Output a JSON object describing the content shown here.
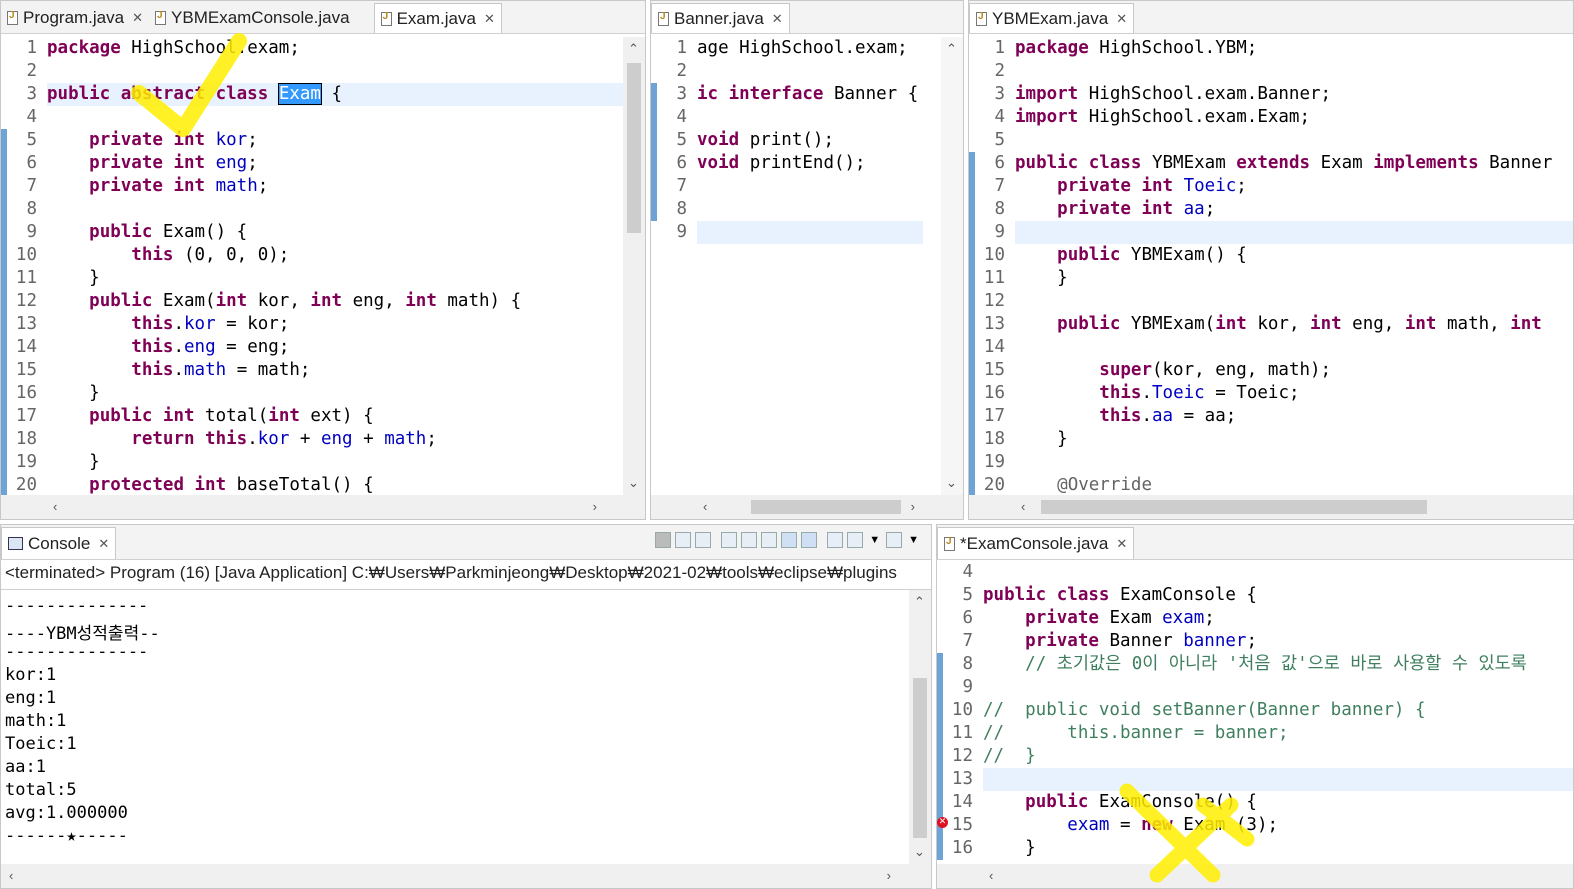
{
  "panes": {
    "left_editor": {
      "tabs": [
        {
          "label": "Program.java",
          "active": false
        },
        {
          "label": "YBMExamConsole.java",
          "active": false
        },
        {
          "label": "Exam.java",
          "active": true
        }
      ],
      "lines": [
        {
          "n": "1",
          "html": "<span class='kw'>package</span> HighSchool.exam;"
        },
        {
          "n": "2",
          "html": ""
        },
        {
          "n": "3",
          "html": "<span class='kw'>public abstract class</span> <span class='sel'>Exam</span> {"
        },
        {
          "n": "4",
          "html": ""
        },
        {
          "n": "5",
          "html": "    <span class='kw'>private int</span> <span class='fd'>kor</span>;"
        },
        {
          "n": "6",
          "html": "    <span class='kw'>private int</span> <span class='fd'>eng</span>;"
        },
        {
          "n": "7",
          "html": "    <span class='kw'>private int</span> <span class='fd'>math</span>;"
        },
        {
          "n": "8",
          "html": ""
        },
        {
          "n": "9",
          "html": "    <span class='kw'>public</span> Exam() {"
        },
        {
          "n": "10",
          "html": "        <span class='kw'>this</span> (0, 0, 0);"
        },
        {
          "n": "11",
          "html": "    }"
        },
        {
          "n": "12",
          "html": "    <span class='kw'>public</span> Exam(<span class='kw'>int</span> kor, <span class='kw'>int</span> eng, <span class='kw'>int</span> math) {"
        },
        {
          "n": "13",
          "html": "        <span class='kw'>this</span>.<span class='fd'>kor</span> = kor;"
        },
        {
          "n": "14",
          "html": "        <span class='kw'>this</span>.<span class='fd'>eng</span> = eng;"
        },
        {
          "n": "15",
          "html": "        <span class='kw'>this</span>.<span class='fd'>math</span> = math;"
        },
        {
          "n": "16",
          "html": "    }"
        },
        {
          "n": "17",
          "html": "    <span class='kw'>public int</span> total(<span class='kw'>int</span> ext) {"
        },
        {
          "n": "18",
          "html": "        <span class='kw'>return this</span>.<span class='fd'>kor</span> + <span class='fd'>eng</span> + <span class='fd'>math</span>;"
        },
        {
          "n": "19",
          "html": "    }"
        },
        {
          "n": "20",
          "html": "    <span class='kw'>protected int</span> baseTotal() {"
        }
      ]
    },
    "mid_editor": {
      "tabs": [
        {
          "label": "Banner.java",
          "active": true
        }
      ],
      "lines": [
        {
          "n": "1",
          "html": "age HighSchool.exam;"
        },
        {
          "n": "2",
          "html": ""
        },
        {
          "n": "3",
          "html": "<span class='kw'>ic interface</span> Banner {"
        },
        {
          "n": "4",
          "html": ""
        },
        {
          "n": "5",
          "html": "<span class='kw'>void</span> print();"
        },
        {
          "n": "6",
          "html": "<span class='kw'>void</span> printEnd();"
        },
        {
          "n": "7",
          "html": ""
        },
        {
          "n": "8",
          "html": ""
        },
        {
          "n": "9",
          "html": ""
        }
      ]
    },
    "right_editor": {
      "tabs": [
        {
          "label": "YBMExam.java",
          "active": true
        }
      ],
      "lines": [
        {
          "n": "1",
          "html": "<span class='kw'>package</span> HighSchool.YBM;"
        },
        {
          "n": "2",
          "html": ""
        },
        {
          "n": "3",
          "html": "<span class='kw'>import</span> HighSchool.exam.Banner;"
        },
        {
          "n": "4",
          "html": "<span class='kw'>import</span> HighSchool.exam.Exam;"
        },
        {
          "n": "5",
          "html": ""
        },
        {
          "n": "6",
          "html": "<span class='kw'>public class</span> YBMExam <span class='kw'>extends</span> Exam <span class='kw'>implements</span> Banner"
        },
        {
          "n": "7",
          "html": "    <span class='kw'>private int</span> <span class='fd'>Toeic</span>;"
        },
        {
          "n": "8",
          "html": "    <span class='kw'>private int</span> <span class='fd'>aa</span>;"
        },
        {
          "n": "9",
          "html": ""
        },
        {
          "n": "10",
          "html": "    <span class='kw'>public</span> YBMExam() {"
        },
        {
          "n": "11",
          "html": "    }"
        },
        {
          "n": "12",
          "html": ""
        },
        {
          "n": "13",
          "html": "    <span class='kw'>public</span> YBMExam(<span class='kw'>int</span> kor, <span class='kw'>int</span> eng, <span class='kw'>int</span> math, <span class='kw'>int</span>"
        },
        {
          "n": "14",
          "html": ""
        },
        {
          "n": "15",
          "html": "        <span class='kw'>super</span>(kor, eng, math);"
        },
        {
          "n": "16",
          "html": "        <span class='kw'>this</span>.<span class='fd'>Toeic</span> = Toeic;"
        },
        {
          "n": "17",
          "html": "        <span class='kw'>this</span>.<span class='fd'>aa</span> = aa;"
        },
        {
          "n": "18",
          "html": "    }"
        },
        {
          "n": "19",
          "html": ""
        },
        {
          "n": "20",
          "html": "    <span class='an'>@Override</span>"
        }
      ]
    },
    "console": {
      "tab_label": "Console",
      "status": "<terminated> Program (16) [Java Application] C:₩Users₩Parkminjeong₩Desktop₩2021-02₩tools₩eclipse₩plugins",
      "output": [
        "--------------",
        "----YBM성적출력--",
        "--------------",
        "kor:1",
        "eng:1",
        "math:1",
        "Toeic:1",
        "aa:1",
        "total:5",
        "avg:1.000000",
        "------★-----"
      ]
    },
    "bottom_editor": {
      "tabs": [
        {
          "label": "*ExamConsole.java",
          "active": true
        }
      ],
      "lines": [
        {
          "n": "4",
          "html": ""
        },
        {
          "n": "5",
          "html": "<span class='kw'>public class</span> ExamConsole {"
        },
        {
          "n": "6",
          "html": "    <span class='kw'>private</span> Exam <span class='fd'>exam</span>;"
        },
        {
          "n": "7",
          "html": "    <span class='kw'>private</span> Banner <span class='fd'>banner</span>;"
        },
        {
          "n": "8",
          "html": "    <span class='cm'>// 초기값은 0이 아니라 '처음 값'으로 바로 사용할 수 있도록</span>"
        },
        {
          "n": "9",
          "html": ""
        },
        {
          "n": "10",
          "html": "<span class='cm'>//  public void setBanner(Banner banner) {</span>"
        },
        {
          "n": "11",
          "html": "<span class='cm'>//      this.banner = banner;</span>"
        },
        {
          "n": "12",
          "html": "<span class='cm'>//  }</span>"
        },
        {
          "n": "13",
          "html": ""
        },
        {
          "n": "14",
          "html": "    <span class='kw'>public</span> ExamConsole() {"
        },
        {
          "n": "15",
          "html": "        <span class='fd'>exam</span> = <span class='kw'>new</span> Exam (3);"
        },
        {
          "n": "16",
          "html": "    }"
        }
      ]
    }
  },
  "colors": {
    "keyword": "#7f0055",
    "field": "#0000c0",
    "comment": "#3f7f5f",
    "highlighter": "#ffee00"
  }
}
